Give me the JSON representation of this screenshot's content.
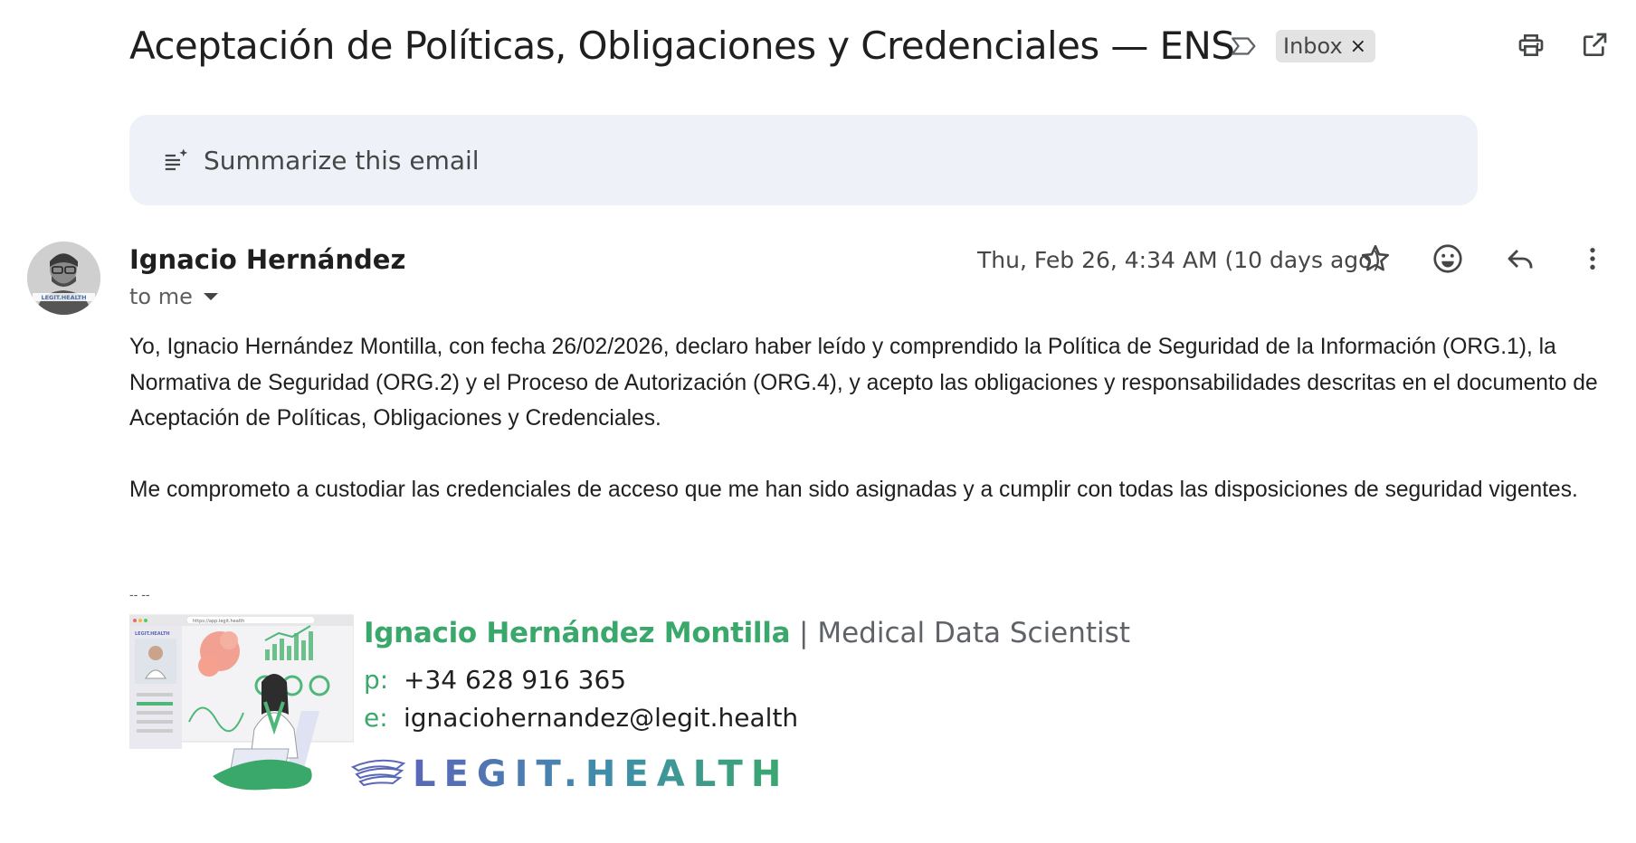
{
  "subject": "Aceptación de Políticas, Obligaciones y Credenciales — ENS",
  "label": {
    "name": "Inbox",
    "remove": "×"
  },
  "summary": {
    "label": "Summarize this email"
  },
  "message": {
    "sender": "Ignacio Hernández",
    "recipient": "to me",
    "date": "Thu, Feb 26, 4:34 AM (10 days ago)",
    "avatar_text": "LEGIT.HEALTH",
    "body": [
      "Yo, Ignacio Hernández Montilla, con fecha 26/02/2026, declaro haber leído y comprendido la Política de Seguridad de la Información (ORG.1), la Normativa de Seguridad (ORG.2) y el Proceso de Autorización (ORG.4), y acepto las obligaciones y responsabilidades descritas en el documento de Aceptación de Políticas, Obligaciones y Credenciales.",
      "Me comprometo a custodiar las credenciales de acceso que me han sido asignadas y a cumplir con todas las disposiciones de seguridad vigentes."
    ],
    "signature_separator": "-- --"
  },
  "signature": {
    "name": "Ignacio Hernández Montilla",
    "divider": " | ",
    "title": "Medical Data Scientist",
    "phone_label": "p:",
    "phone": "+34 628 916 365",
    "email_label": "e:",
    "email": "ignaciohernandez@legit.health",
    "logo_text": "LEGIT.HEALTH",
    "illustration_url": "https://app.legit.health"
  },
  "icons": {
    "importance": "label-important-outline-icon",
    "print": "print-icon",
    "open_new": "open-in-new-window-icon",
    "summarize": "summarize-sparkle-icon",
    "star": "star-outline-icon",
    "emoji": "emoji-react-icon",
    "reply": "reply-icon",
    "more": "more-vert-icon"
  },
  "colors": {
    "summary_bg": "#eef2f8",
    "label_bg": "#e3e3e3",
    "brand_green": "#3aa86b",
    "brand_blue": "#5a67b8"
  }
}
